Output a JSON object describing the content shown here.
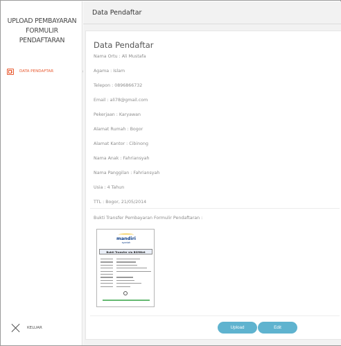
{
  "sidebar": {
    "title_lines": [
      "UPLOAD PEMBAYARAN",
      "FORMULIR",
      "PENDAFTARAN"
    ],
    "items": [
      {
        "label": "DATA PENDAFTAR",
        "icon": "id-card-icon",
        "active": true,
        "color": "#e8592f"
      }
    ],
    "logout_label": "KELUAR",
    "logout_icon": "close-icon"
  },
  "header": {
    "title": "Data Pendaftar"
  },
  "card": {
    "title": "Data Pendaftar",
    "fields": [
      "Nama Ortu : Ali Mustafa",
      "Agama : Islam",
      "Telepon : 0896866732",
      "Email : ali78@gmail.com",
      "Pekerjaan : Karyawan",
      "Alamat Rumah : Bogor",
      "Alamat Kantor : Cibinong",
      "Nama Anak : Fahriansyah",
      "Nama Panggilan : Fahriansyah",
      "Usia : 4 Tahun",
      "TTL : Bogor, 21/05/2014"
    ],
    "bukti_label": "Bukti Transfer Pembayaran Formulir Pendaftaran :",
    "receipt": {
      "bank_name": "mandiri",
      "bank_sub": "syariah",
      "heading": "Bukti Transfer via BSMNet"
    }
  },
  "actions": {
    "upload_label": "Upload",
    "edit_label": "Edit",
    "button_color": "#5fb3cf"
  }
}
